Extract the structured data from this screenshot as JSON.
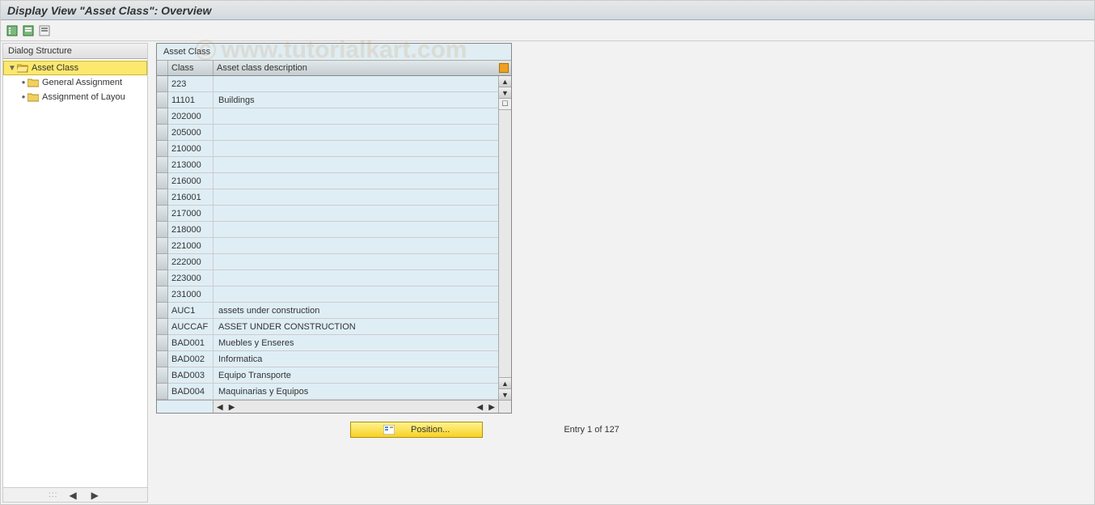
{
  "title": "Display View \"Asset Class\": Overview",
  "watermark": "www.tutorialkart.com",
  "sidebar": {
    "header": "Dialog Structure",
    "items": [
      {
        "label": "Asset Class",
        "selected": true,
        "open": true,
        "children": true
      },
      {
        "label": "General Assignment",
        "selected": false
      },
      {
        "label": "Assignment of Layou",
        "selected": false
      }
    ]
  },
  "table": {
    "title": "Asset Class",
    "columns": [
      "Class",
      "Asset class description"
    ],
    "rows": [
      {
        "class": "223",
        "desc": ""
      },
      {
        "class": "11101",
        "desc": "Buildings"
      },
      {
        "class": "202000",
        "desc": ""
      },
      {
        "class": "205000",
        "desc": ""
      },
      {
        "class": "210000",
        "desc": ""
      },
      {
        "class": "213000",
        "desc": ""
      },
      {
        "class": "216000",
        "desc": ""
      },
      {
        "class": "216001",
        "desc": ""
      },
      {
        "class": "217000",
        "desc": ""
      },
      {
        "class": "218000",
        "desc": ""
      },
      {
        "class": "221000",
        "desc": ""
      },
      {
        "class": "222000",
        "desc": ""
      },
      {
        "class": "223000",
        "desc": ""
      },
      {
        "class": "231000",
        "desc": ""
      },
      {
        "class": "AUC1",
        "desc": "assets under construction"
      },
      {
        "class": "AUCCAF",
        "desc": "ASSET UNDER CONSTRUCTION"
      },
      {
        "class": "BAD001",
        "desc": "Muebles y Enseres"
      },
      {
        "class": "BAD002",
        "desc": "Informatica"
      },
      {
        "class": "BAD003",
        "desc": "Equipo Transporte"
      },
      {
        "class": "BAD004",
        "desc": "Maquinarias y Equipos"
      }
    ]
  },
  "footer": {
    "position_button": "Position...",
    "entry_text": "Entry 1 of 127"
  }
}
